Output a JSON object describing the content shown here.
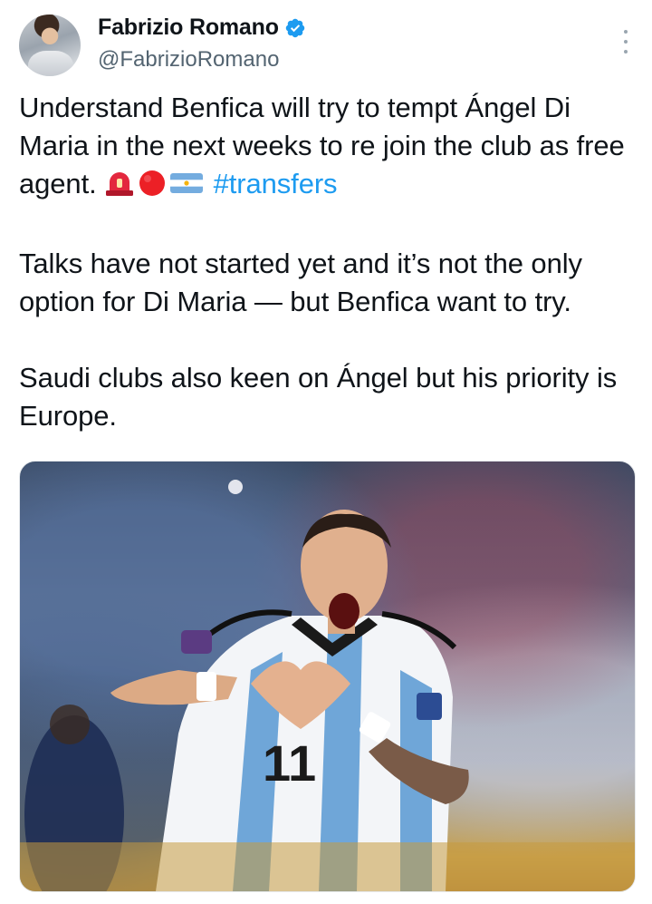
{
  "author": {
    "display_name": "Fabrizio Romano",
    "handle": "@FabrizioRomano",
    "verified": true,
    "verified_color": "#1d9bf0"
  },
  "tweet": {
    "paragraph_1_text": "Understand Benfica will try to tempt Ángel Di Maria in the next weeks to re join the club as free agent.",
    "emojis": [
      "rotating-light-icon",
      "red-circle-icon",
      "argentina-flag-icon"
    ],
    "hashtag": "#transfers",
    "paragraph_2": "Talks have not started yet and it’s not the only option for Di Maria — but Benfica want to try.",
    "paragraph_3": "Saudi clubs also keen on Ángel but his priority is Europe."
  },
  "media": {
    "shirt_number": "11"
  },
  "colors": {
    "text": "#0f1419",
    "secondary_text": "#536471",
    "link": "#1d9bf0"
  }
}
